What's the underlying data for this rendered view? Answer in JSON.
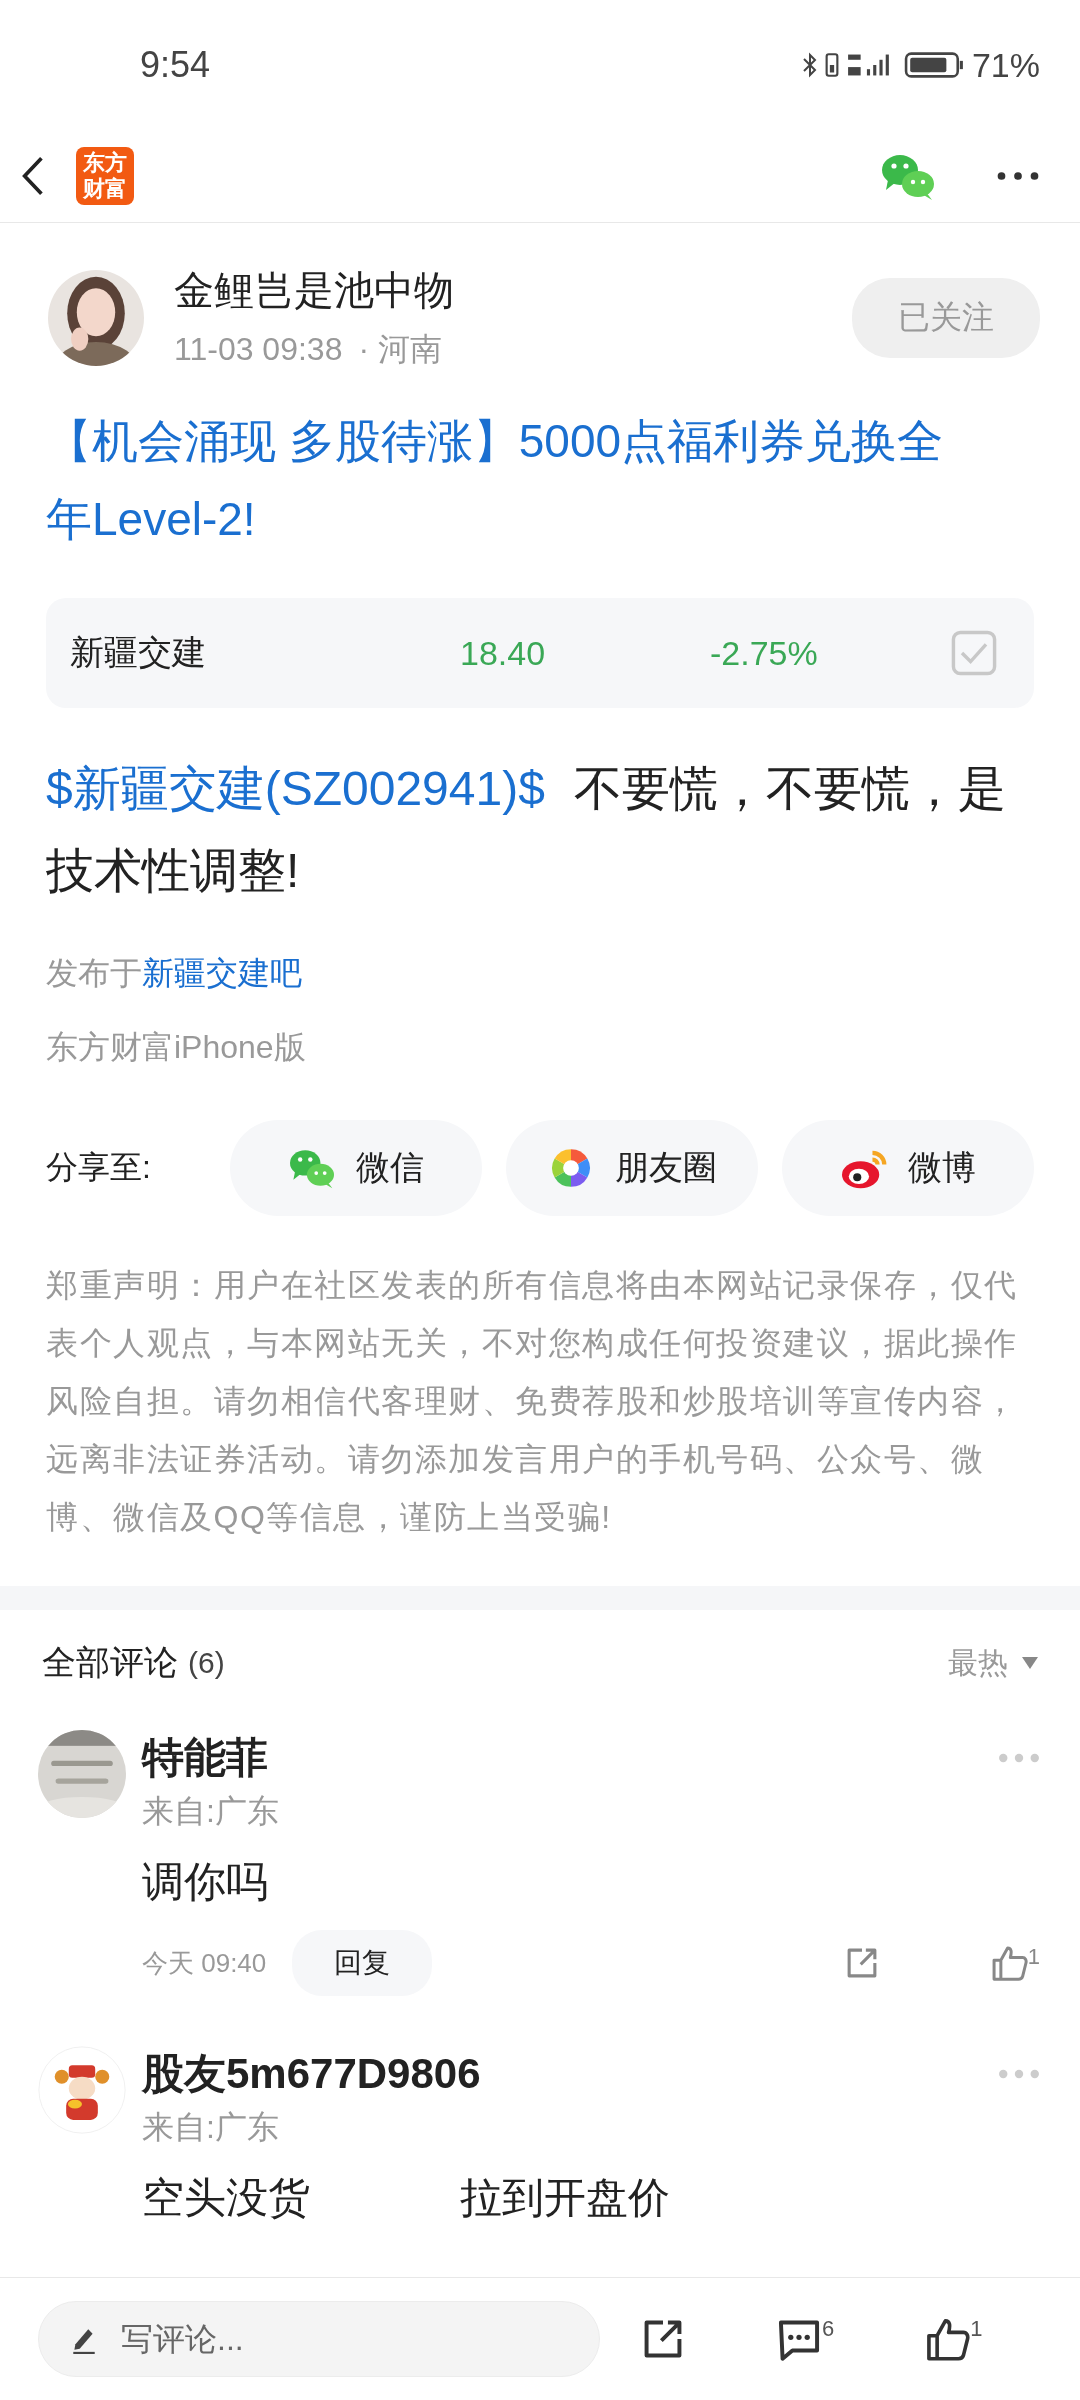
{
  "status_bar": {
    "time": "9:54",
    "battery": "71%"
  },
  "nav": {
    "logo": "东方财富"
  },
  "author": {
    "name": "金鲤岂是池中物",
    "time": "11-03 09:38",
    "location": "· 河南",
    "follow": {
      "label": "已关注",
      "selected": true
    }
  },
  "post": {
    "title": "【机会涌现 多股待涨】5000点福利券兑换全年Level-2!",
    "stock": {
      "name": "新疆交建",
      "price": "18.40",
      "change": "-2.75%",
      "checked": true
    },
    "body": {
      "tag": "$新疆交建(SZ002941)$",
      "text": " 不要慌，不要慌，是技术性调整!"
    },
    "forum_prefix": "发布于",
    "forum": "新疆交建吧",
    "source": "东方财富iPhone版"
  },
  "share": {
    "label": "分享至:",
    "targets": [
      {
        "kind": "wechat",
        "label": "微信"
      },
      {
        "kind": "moments",
        "label": "朋友圈"
      },
      {
        "kind": "weibo",
        "label": "微博"
      }
    ]
  },
  "disclaimer": "郑重声明：用户在社区发表的所有信息将由本网站记录保存，仅代表个人观点，与本网站无关，不对您构成任何投资建议，据此操作风险自担。请勿相信代客理财、免费荐股和炒股培训等宣传内容，远离非法证券活动。请勿添加发言用户的手机号码、公众号、微博、微信及QQ等信息，谨防上当受骗!",
  "comments_header": {
    "title": "全部评论",
    "count": "(6)",
    "sort": "最热"
  },
  "comments": [
    {
      "name": "特能菲",
      "location": "来自:广东",
      "text": [
        "调你吗"
      ],
      "time": "今天 09:40",
      "reply": "回复",
      "likes": "1"
    },
    {
      "name": "股友5m677D9806",
      "location": "来自:广东",
      "text": [
        "空头没货",
        "拉到开盘价"
      ]
    }
  ],
  "bottom_bar": {
    "placeholder": "写评论...",
    "comment_count": "6",
    "like_count": "1"
  }
}
